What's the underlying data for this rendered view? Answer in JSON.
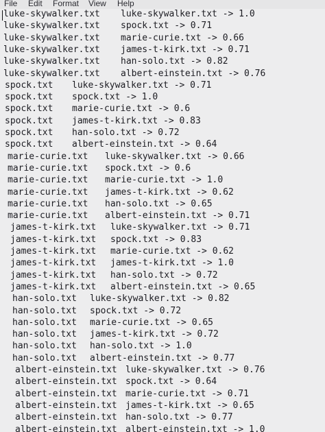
{
  "menubar": {
    "items": [
      "File",
      "Edit",
      "Format",
      "View",
      "Help"
    ]
  },
  "lines": [
    [
      "luke-skywalker.txt",
      "luke-skywalker.txt -> 1.0"
    ],
    [
      "luke-skywalker.txt",
      "spock.txt -> 0.71"
    ],
    [
      "luke-skywalker.txt",
      "marie-curie.txt -> 0.66"
    ],
    [
      "luke-skywalker.txt",
      "james-t-kirk.txt -> 0.71"
    ],
    [
      "luke-skywalker.txt",
      "han-solo.txt -> 0.82"
    ],
    [
      "luke-skywalker.txt",
      "albert-einstein.txt -> 0.76"
    ],
    [
      "spock.txt",
      "luke-skywalker.txt -> 0.71"
    ],
    [
      "spock.txt",
      "spock.txt -> 1.0"
    ],
    [
      "spock.txt",
      "marie-curie.txt -> 0.6"
    ],
    [
      "spock.txt",
      "james-t-kirk.txt -> 0.83"
    ],
    [
      "spock.txt",
      "han-solo.txt -> 0.72"
    ],
    [
      "spock.txt",
      "albert-einstein.txt -> 0.64"
    ],
    [
      "marie-curie.txt",
      "luke-skywalker.txt -> 0.66"
    ],
    [
      "marie-curie.txt",
      "spock.txt -> 0.6"
    ],
    [
      "marie-curie.txt",
      "marie-curie.txt -> 1.0"
    ],
    [
      "marie-curie.txt",
      "james-t-kirk.txt -> 0.62"
    ],
    [
      "marie-curie.txt",
      "han-solo.txt -> 0.65"
    ],
    [
      "marie-curie.txt",
      "albert-einstein.txt -> 0.71"
    ],
    [
      "james-t-kirk.txt",
      "luke-skywalker.txt -> 0.71"
    ],
    [
      "james-t-kirk.txt",
      "spock.txt -> 0.83"
    ],
    [
      "james-t-kirk.txt",
      "marie-curie.txt -> 0.62"
    ],
    [
      "james-t-kirk.txt",
      "james-t-kirk.txt -> 1.0"
    ],
    [
      "james-t-kirk.txt",
      "han-solo.txt -> 0.72"
    ],
    [
      "james-t-kirk.txt",
      "albert-einstein.txt -> 0.65"
    ],
    [
      "han-solo.txt",
      "luke-skywalker.txt -> 0.82"
    ],
    [
      "han-solo.txt",
      "spock.txt -> 0.72"
    ],
    [
      "han-solo.txt",
      "marie-curie.txt -> 0.65"
    ],
    [
      "han-solo.txt",
      "james-t-kirk.txt -> 0.72"
    ],
    [
      "han-solo.txt",
      "han-solo.txt -> 1.0"
    ],
    [
      "han-solo.txt",
      "albert-einstein.txt -> 0.77"
    ],
    [
      "albert-einstein.txt",
      "luke-skywalker.txt -> 0.76"
    ],
    [
      "albert-einstein.txt",
      "spock.txt -> 0.64"
    ],
    [
      "albert-einstein.txt",
      "marie-curie.txt -> 0.71"
    ],
    [
      "albert-einstein.txt",
      "james-t-kirk.txt -> 0.65"
    ],
    [
      "albert-einstein.txt",
      "han-solo.txt -> 0.77"
    ],
    [
      "albert-einstein.txt",
      "albert-einstein.txt -> 1.0"
    ]
  ]
}
